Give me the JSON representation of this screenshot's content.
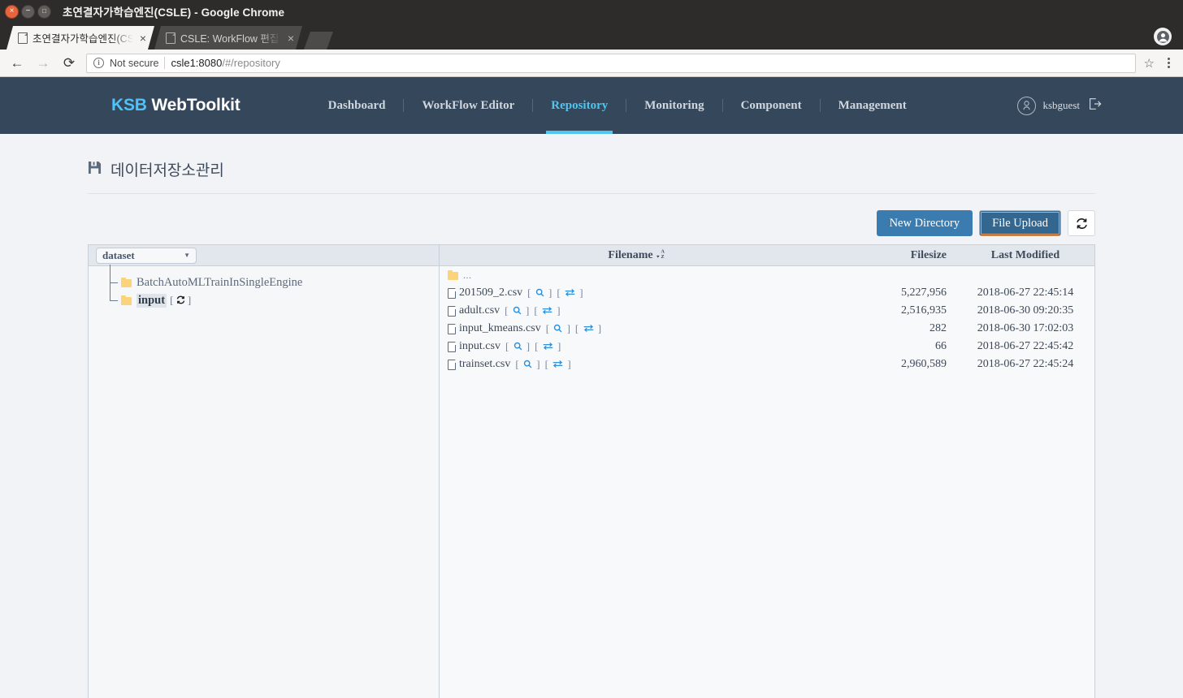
{
  "browser": {
    "window_title": "초연결자가학습엔진(CSLE) - Google Chrome",
    "tabs": [
      {
        "title": "초연결자가학습엔진(CSLE)",
        "active": true
      },
      {
        "title": "CSLE: WorkFlow 편집",
        "active": false
      }
    ],
    "security_label": "Not secure",
    "url_host": "csle1:8080",
    "url_path": "/#/repository"
  },
  "navbar": {
    "brand_ksb": "KSB",
    "brand_rest": " WebToolkit",
    "links": [
      {
        "label": "Dashboard",
        "active": false
      },
      {
        "label": "WorkFlow Editor",
        "active": false
      },
      {
        "label": "Repository",
        "active": true
      },
      {
        "label": "Monitoring",
        "active": false
      },
      {
        "label": "Component",
        "active": false
      },
      {
        "label": "Management",
        "active": false
      }
    ],
    "username": "ksbguest"
  },
  "page": {
    "title": "데이터저장소관리"
  },
  "toolbar": {
    "new_directory": "New Directory",
    "file_upload": "File Upload",
    "refresh": "⟳"
  },
  "tree": {
    "selector_value": "dataset",
    "items": [
      {
        "label": "BatchAutoMLTrainInSingleEngine",
        "selected": false,
        "has_refresh": false
      },
      {
        "label": "input",
        "selected": true,
        "has_refresh": true
      }
    ]
  },
  "table": {
    "columns": {
      "filename": "Filename",
      "filesize": "Filesize",
      "modified": "Last Modified"
    },
    "parent_row": "...",
    "rows": [
      {
        "name": "201509_2.csv",
        "size": "5,227,956",
        "modified": "2018-06-27 22:45:14"
      },
      {
        "name": "adult.csv",
        "size": "2,516,935",
        "modified": "2018-06-30 09:20:35"
      },
      {
        "name": "input_kmeans.csv",
        "size": "282",
        "modified": "2018-06-30 17:02:03"
      },
      {
        "name": "input.csv",
        "size": "66",
        "modified": "2018-06-27 22:45:42"
      },
      {
        "name": "trainset.csv",
        "size": "2,960,589",
        "modified": "2018-06-27 22:45:24"
      }
    ]
  },
  "colors": {
    "navbar": "#35475a",
    "accent": "#4ec7f0",
    "primary_button": "#3a7cb0",
    "focus_outline": "#e8a26a",
    "folder": "#fbd37a",
    "link": "#2f8fd8"
  }
}
